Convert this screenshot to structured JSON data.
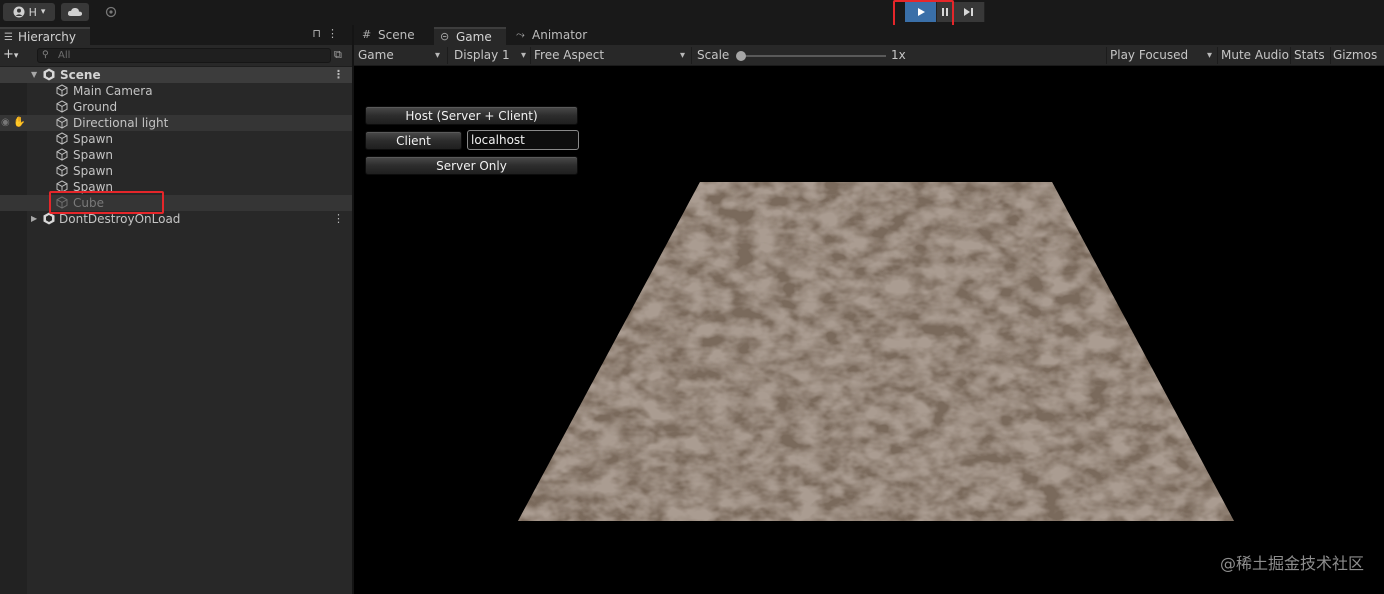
{
  "toolbar": {
    "account_label": "H",
    "account_icon": "account-icon",
    "cloud_icon": "cloud-icon",
    "collab_icon": "collab-icon",
    "play_icon": "play-icon",
    "pause_icon": "pause-icon",
    "step_icon": "step-icon",
    "play_state": "playing",
    "highlight_color": "#e5262a"
  },
  "hierarchy": {
    "tab_label": "Hierarchy",
    "search_placeholder": "All",
    "scene": {
      "label": "Scene",
      "children": [
        "Main Camera",
        "Ground",
        "Directional light",
        "Spawn",
        "Spawn",
        "Spawn",
        "Spawn",
        "Cube"
      ]
    },
    "dont_destroy": "DontDestroyOnLoad"
  },
  "tabs": [
    "Scene",
    "Game",
    "Animator"
  ],
  "gamebar": {
    "mode": "Game",
    "display": "Display 1",
    "aspect": "Free Aspect",
    "scale_label": "Scale",
    "scale_value": "1x",
    "play_focused": "Play Focused",
    "mute": "Mute Audio",
    "stats": "Stats",
    "gizmos": "Gizmos"
  },
  "network_ui": {
    "host_button": "Host (Server + Client)",
    "client_button": "Client",
    "address_value": "localhost",
    "server_button": "Server Only"
  },
  "watermark": "@稀土掘金技术社区"
}
